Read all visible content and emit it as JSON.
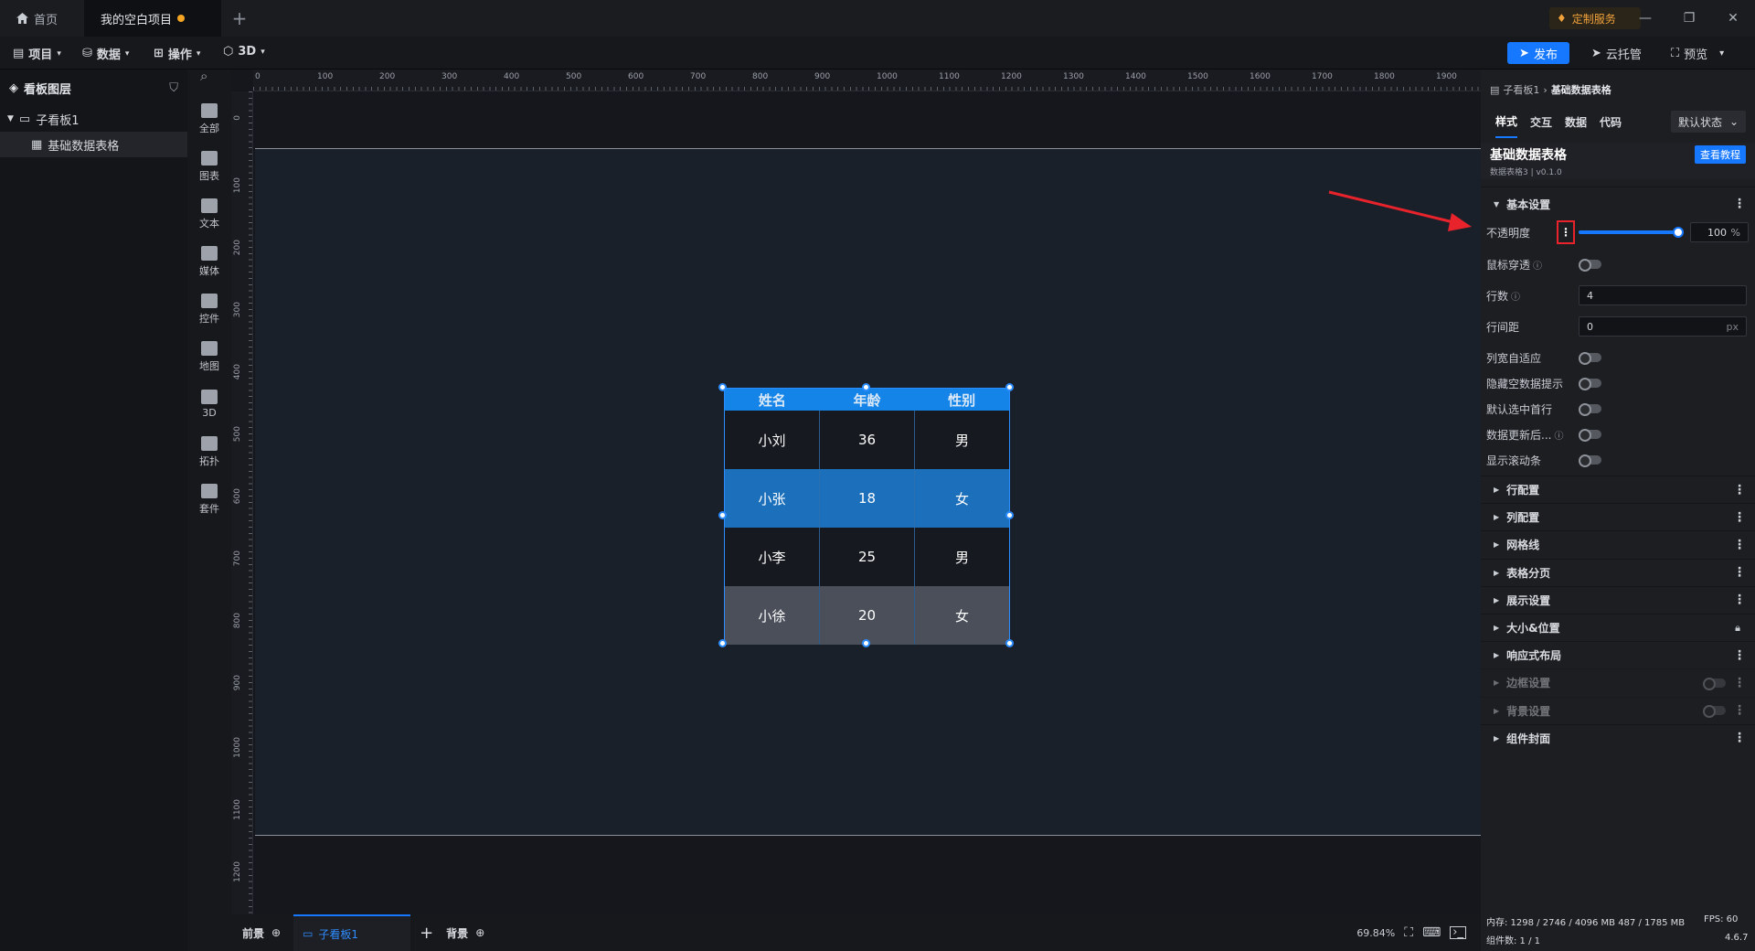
{
  "titlebar": {
    "home_tab": "首页",
    "project_tab": "我的空白项目",
    "custom_service": "定制服务"
  },
  "menubar": {
    "items": [
      "项目",
      "数据",
      "操作",
      "3D"
    ],
    "publish": "发布",
    "cloud": "云托管",
    "preview": "预览"
  },
  "layers": {
    "title": "看板图层",
    "board": "子看板1",
    "component": "基础数据表格"
  },
  "rail": [
    "全部",
    "图表",
    "文本",
    "媒体",
    "控件",
    "地图",
    "3D",
    "拓扑",
    "套件"
  ],
  "ruler_top": [
    "0",
    "100",
    "200",
    "300",
    "400",
    "500",
    "600",
    "700",
    "800",
    "900",
    "1000",
    "1100",
    "1200",
    "1300",
    "1400",
    "1500",
    "1600",
    "1700",
    "1800",
    "1900"
  ],
  "ruler_left": [
    "0",
    "100",
    "200",
    "300",
    "400",
    "500",
    "600",
    "700",
    "800",
    "900",
    "1000",
    "1100",
    "1200"
  ],
  "table": {
    "headers": [
      "姓名",
      "年龄",
      "性别"
    ],
    "rows": [
      [
        "小刘",
        "36",
        "男"
      ],
      [
        "小张",
        "18",
        "女"
      ],
      [
        "小李",
        "25",
        "男"
      ],
      [
        "小徐",
        "20",
        "女"
      ]
    ],
    "row_colors": [
      "#16191f",
      "#1c6fba",
      "#16191f",
      "#4a4f5a"
    ]
  },
  "bottombar": {
    "foreground": "前景",
    "board_tab": "子看板1",
    "background": "背景",
    "zoom": "69.84%"
  },
  "rpanel": {
    "breadcrumb_parent": "子看板1",
    "breadcrumb_current": "基础数据表格",
    "tabs": [
      "样式",
      "交互",
      "数据",
      "代码"
    ],
    "state": "默认状态",
    "comp_title": "基础数据表格",
    "comp_sub": "数据表格3 | v0.1.0",
    "tutorial": "查看教程",
    "basic_section": "基本设置",
    "opacity_label": "不透明度",
    "opacity_value": "100",
    "opacity_unit": "%",
    "opacity_fraction": 1.0,
    "mouse_through": "鼠标穿透",
    "rows_label": "行数",
    "rows_value": "4",
    "row_gap_label": "行间距",
    "row_gap_value": "0",
    "row_gap_unit": "px",
    "toggles": [
      "列宽自适应",
      "隐藏空数据提示",
      "默认选中首行",
      "数据更新后...",
      "显示滚动条"
    ],
    "sections": [
      "行配置",
      "列配置",
      "网格线",
      "表格分页",
      "展示设置",
      "大小&位置",
      "响应式布局",
      "边框设置",
      "背景设置",
      "组件封面"
    ]
  },
  "status": {
    "memory": "内存: 1298 / 2746 / 4096 MB  487 / 1785 MB",
    "fps": "FPS: 60",
    "count": "组件数: 1 / 1",
    "version": "4.6.7"
  },
  "colors": {
    "accent": "#1677ff",
    "table_header": "#1584e8",
    "annotation_red": "#e8232b"
  }
}
